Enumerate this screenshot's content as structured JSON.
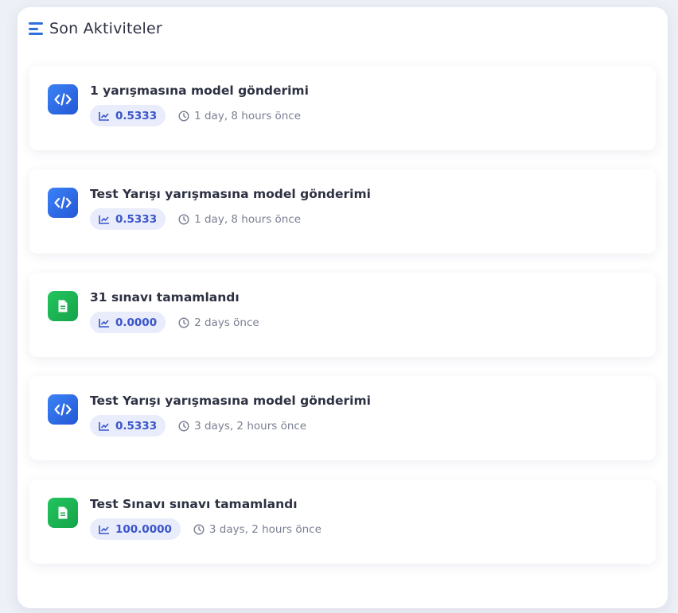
{
  "header": {
    "title": "Son Aktiviteler",
    "icon": "list-icon"
  },
  "colors": {
    "accent": "#2f6fdc",
    "code_icon_bg": "#2f6fdc",
    "doc_icon_bg": "#22c55e",
    "badge_bg": "#e8ecfb",
    "badge_text": "#3a55c9"
  },
  "activities": [
    {
      "icon": "code-icon",
      "title": "1 yarışmasına model gönderimi",
      "score": "0.5333",
      "time": "1 day, 8 hours önce"
    },
    {
      "icon": "code-icon",
      "title": "Test Yarışı yarışmasına model gönderimi",
      "score": "0.5333",
      "time": "1 day, 8 hours önce"
    },
    {
      "icon": "document-icon",
      "title": "31 sınavı tamamlandı",
      "score": "0.0000",
      "time": "2 days önce"
    },
    {
      "icon": "code-icon",
      "title": "Test Yarışı yarışmasına model gönderimi",
      "score": "0.5333",
      "time": "3 days, 2 hours önce"
    },
    {
      "icon": "document-icon",
      "title": "Test Sınavı sınavı tamamlandı",
      "score": "100.0000",
      "time": "3 days, 2 hours önce"
    }
  ]
}
